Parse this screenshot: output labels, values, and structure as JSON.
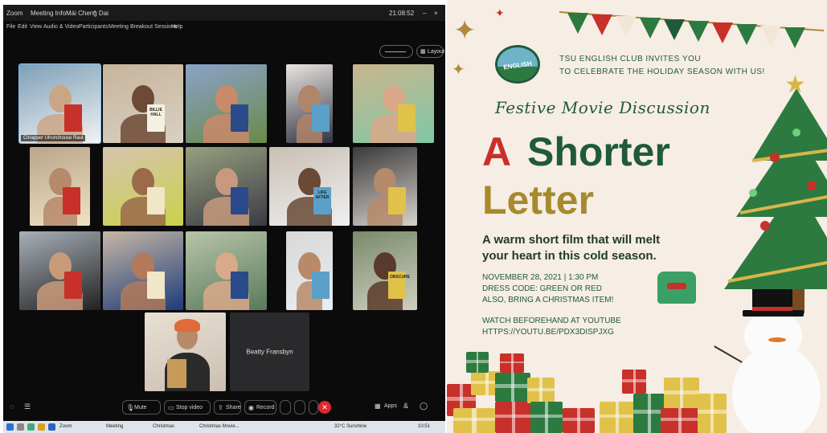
{
  "zoom": {
    "title": {
      "app": "Zoom",
      "meeting": "Meeting Info",
      "view": "Mái Cheng Dai",
      "right": "21:08:52"
    },
    "menu": [
      "File",
      "Edit",
      "View",
      "Audio & Video",
      "Participants",
      "Meeting",
      "Breakout Sessions",
      "Help"
    ],
    "layout_label": "Layout",
    "participants": [
      {
        "name": "Cirrapper Ulrunchouse Raul",
        "show_name": true
      },
      {
        "name": "",
        "book": "BILLIE HALL"
      },
      {
        "name": ""
      },
      {
        "name": ""
      },
      {
        "name": ""
      },
      {
        "name": ""
      },
      {
        "name": ""
      },
      {
        "name": ""
      },
      {
        "name": "",
        "book": "LIFE AFTER"
      },
      {
        "name": ""
      },
      {
        "name": ""
      },
      {
        "name": ""
      },
      {
        "name": ""
      },
      {
        "name": ""
      },
      {
        "name": "",
        "book": "OBSCURE"
      },
      {
        "name": ""
      }
    ],
    "camera_off_name": "Beatty Fransbyn",
    "controls": {
      "mute": "Mute",
      "video": "Stop video",
      "share": "Share",
      "record": "Record",
      "apps": "Apps"
    },
    "taskbar": {
      "items": [
        "Zoom",
        "Meeting",
        "Christmas",
        "Christmas Movie..."
      ],
      "weather": "32°C Sunshine",
      "time": "10:51"
    }
  },
  "poster": {
    "invite_line1": "TSU ENGLISH CLUB INVITES YOU",
    "invite_line2": "TO CELEBRATE THE HOLIDAY SEASON WITH US!",
    "logo_text": "ENGLISH",
    "event_type": "Festive Movie Discussion",
    "title_a": "A",
    "title_shorter": "Shorter",
    "title_letter": "Letter",
    "tagline1": "A warm short film that will melt",
    "tagline2": "your heart in this cold season.",
    "date": "NOVEMBER 28, 2021 | 1:30 PM",
    "dress": "DRESS CODE: GREEN OR RED",
    "bring": "ALSO, BRING A CHRISTMAS ITEM!",
    "watch": "WATCH BEFOREHAND AT YOUTUBE",
    "url": "HTTPS://YOUTU.BE/PDX3DISPJXG",
    "colors": {
      "red": "#c8302a",
      "gold": "#a68a2d",
      "green": "#1f5b3a",
      "tree": "#2c7a3f"
    }
  }
}
